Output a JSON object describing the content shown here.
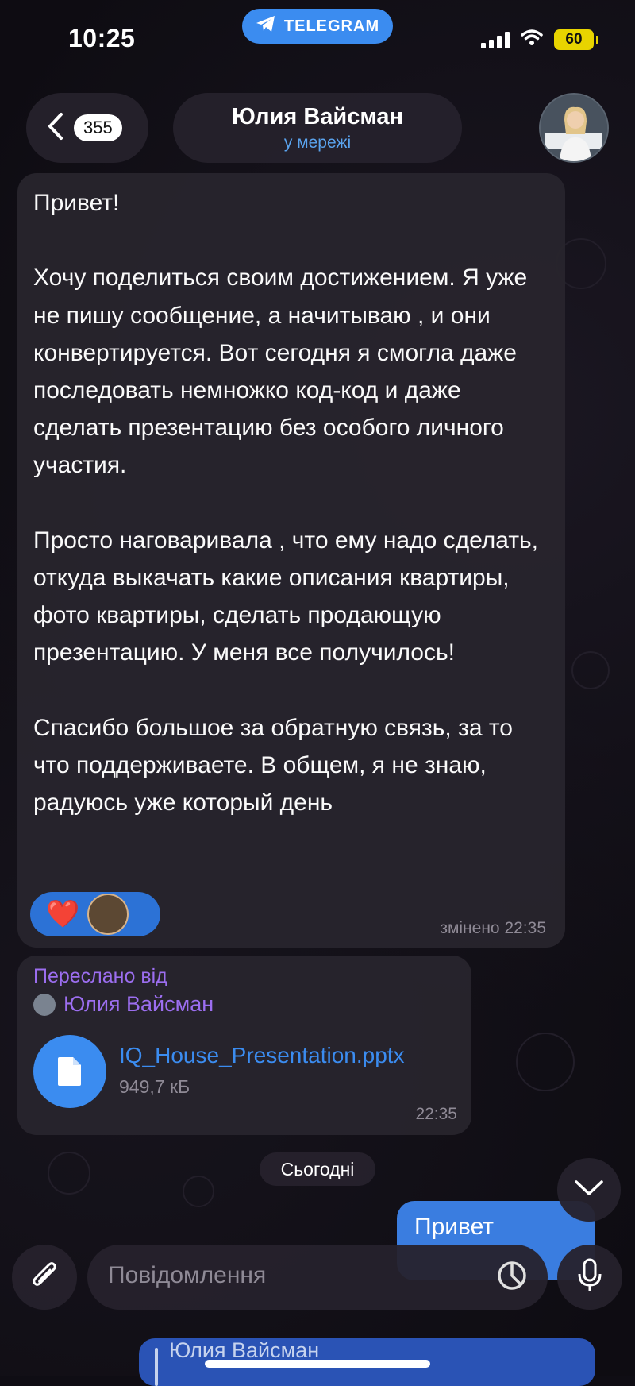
{
  "status_bar": {
    "time": "10:25",
    "app_pill": "TELEGRAM",
    "battery": "60"
  },
  "header": {
    "back_count": "355",
    "contact_name": "Юлия Вайсман",
    "contact_status": "у мережі"
  },
  "messages": {
    "main": {
      "text": "Привет!\n\nХочу поделиться своим достижением. Я уже не пишу сообщение, а начитываю , и они конвертируется. Вот сегодня я смогла даже последовать немножко код-код и даже сделать презентацию без особого личного участия.\n\nПросто наговаривала , что ему надо сделать, откуда выкачать какие описания квартиры, фото квартиры, сделать продающую презентацию. У меня все получилось!\n\nСпасибо большое за обратную связь, за то что поддерживаете. В общем, я не знаю, радуюсь уже который день",
      "edited_label": "змінено 22:35",
      "reaction_emoji": "❤️"
    },
    "forwarded": {
      "label": "Переслано від",
      "author": "Юлия Вайсман",
      "file_name": "IQ_House_Presentation.pptx",
      "file_size": "949,7 кБ",
      "time": "22:35"
    },
    "date_separator": "Сьогодні",
    "outgoing": {
      "text": "Привет"
    },
    "outgoing_reply": {
      "quoted_author": "Юлия Вайсман"
    }
  },
  "input": {
    "placeholder": "Повідомлення"
  },
  "icons": {
    "back": "chevron-left-icon",
    "telegram": "paper-plane-icon",
    "file": "document-icon",
    "scroll_down": "chevron-down-icon",
    "attach": "paperclip-icon",
    "sticker": "sticker-icon",
    "mic": "microphone-icon"
  },
  "colors": {
    "accent": "#3b8cf0",
    "forward_label": "#9c6ef0",
    "outgoing_bubble": "#3a7de0",
    "battery": "#e8d400"
  }
}
